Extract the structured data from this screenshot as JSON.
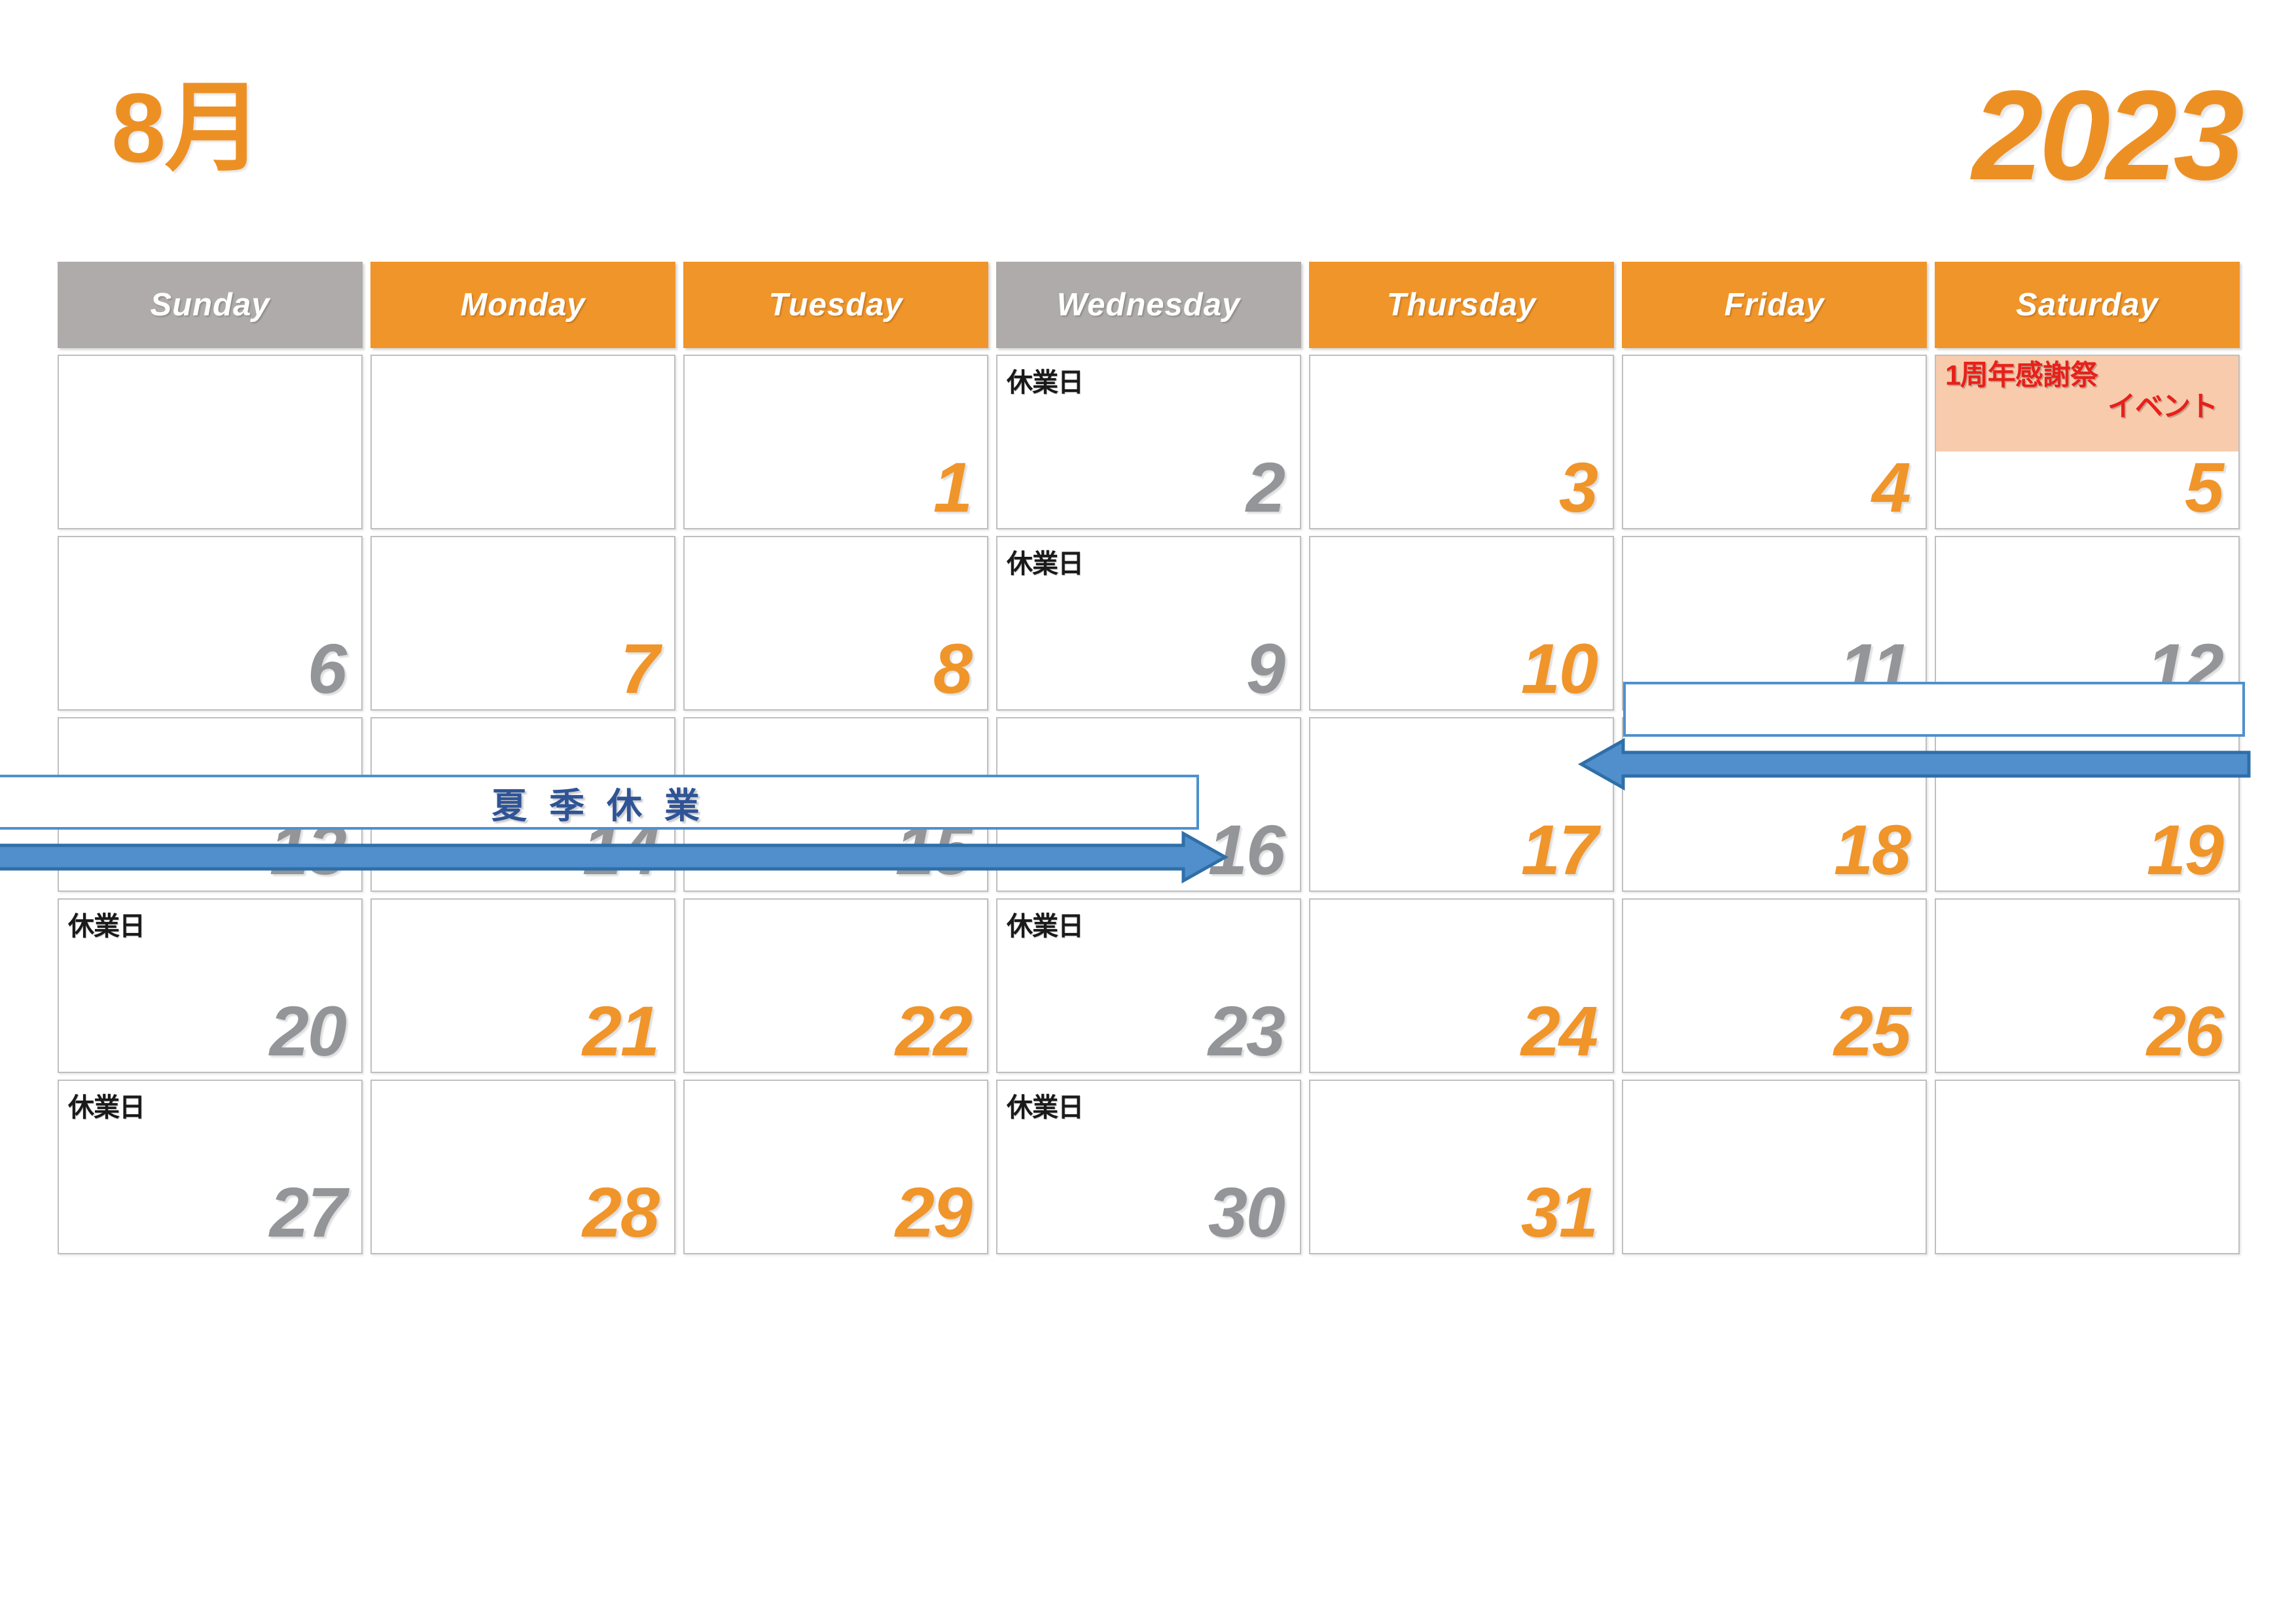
{
  "header": {
    "month_label": "8月",
    "year_label": "2023"
  },
  "colors": {
    "orange": "#F0952A",
    "gray": "#AFABAA",
    "num_gray": "#939598",
    "event_bg": "#F8CBAD",
    "event_text": "#E8201A",
    "band_blue": "#4E90CD",
    "band_text": "#2F5496"
  },
  "weekdays": [
    {
      "label": "Sunday",
      "tone": "gray"
    },
    {
      "label": "Monday",
      "tone": "orange"
    },
    {
      "label": "Tuesday",
      "tone": "orange"
    },
    {
      "label": "Wednesday",
      "tone": "gray"
    },
    {
      "label": "Thursday",
      "tone": "orange"
    },
    {
      "label": "Friday",
      "tone": "orange"
    },
    {
      "label": "Saturday",
      "tone": "orange"
    }
  ],
  "notes": {
    "closed": "休業日",
    "event_line1": "1周年感謝祭",
    "event_line2": "イベント",
    "summer_break": "夏季休業"
  },
  "weeks": [
    [
      {
        "day": "",
        "tone": "",
        "note": ""
      },
      {
        "day": "",
        "tone": "",
        "note": ""
      },
      {
        "day": "1",
        "tone": "orange",
        "note": ""
      },
      {
        "day": "2",
        "tone": "gray",
        "note": "休業日"
      },
      {
        "day": "3",
        "tone": "orange",
        "note": ""
      },
      {
        "day": "4",
        "tone": "orange",
        "note": ""
      },
      {
        "day": "5",
        "tone": "orange",
        "note": "",
        "event": true
      }
    ],
    [
      {
        "day": "6",
        "tone": "gray",
        "note": ""
      },
      {
        "day": "7",
        "tone": "orange",
        "note": ""
      },
      {
        "day": "8",
        "tone": "orange",
        "note": ""
      },
      {
        "day": "9",
        "tone": "gray",
        "note": "休業日"
      },
      {
        "day": "10",
        "tone": "orange",
        "note": ""
      },
      {
        "day": "11",
        "tone": "gray",
        "note": ""
      },
      {
        "day": "12",
        "tone": "gray",
        "note": ""
      }
    ],
    [
      {
        "day": "13",
        "tone": "gray",
        "note": ""
      },
      {
        "day": "14",
        "tone": "gray",
        "note": ""
      },
      {
        "day": "15",
        "tone": "gray",
        "note": ""
      },
      {
        "day": "16",
        "tone": "gray",
        "note": ""
      },
      {
        "day": "17",
        "tone": "orange",
        "note": ""
      },
      {
        "day": "18",
        "tone": "orange",
        "note": ""
      },
      {
        "day": "19",
        "tone": "orange",
        "note": ""
      }
    ],
    [
      {
        "day": "20",
        "tone": "gray",
        "note": "休業日"
      },
      {
        "day": "21",
        "tone": "orange",
        "note": ""
      },
      {
        "day": "22",
        "tone": "orange",
        "note": ""
      },
      {
        "day": "23",
        "tone": "gray",
        "note": "休業日"
      },
      {
        "day": "24",
        "tone": "orange",
        "note": ""
      },
      {
        "day": "25",
        "tone": "orange",
        "note": ""
      },
      {
        "day": "26",
        "tone": "orange",
        "note": ""
      }
    ],
    [
      {
        "day": "27",
        "tone": "gray",
        "note": "休業日"
      },
      {
        "day": "28",
        "tone": "orange",
        "note": ""
      },
      {
        "day": "29",
        "tone": "orange",
        "note": ""
      },
      {
        "day": "30",
        "tone": "gray",
        "note": "休業日"
      },
      {
        "day": "31",
        "tone": "orange",
        "note": ""
      },
      {
        "day": "",
        "tone": "",
        "note": ""
      },
      {
        "day": "",
        "tone": "",
        "note": ""
      }
    ]
  ],
  "bands": [
    {
      "id": "band-week2",
      "label": "",
      "direction": "left"
    },
    {
      "id": "band-summer",
      "label": "夏季休業",
      "direction": "right"
    }
  ]
}
